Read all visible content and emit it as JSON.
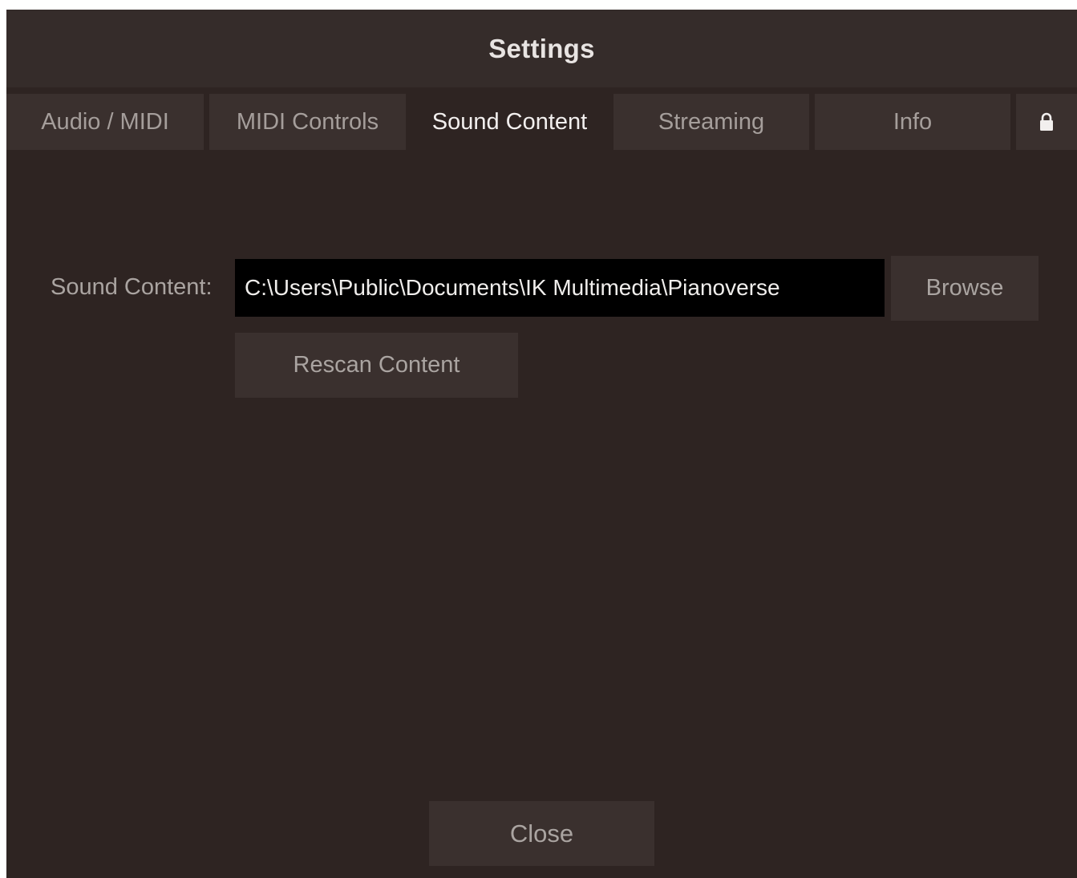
{
  "window": {
    "title": "Settings"
  },
  "tabs": [
    {
      "label": "Audio / MIDI",
      "active": false
    },
    {
      "label": "MIDI Controls",
      "active": false
    },
    {
      "label": "Sound Content",
      "active": true
    },
    {
      "label": "Streaming",
      "active": false
    },
    {
      "label": "Info",
      "active": false
    },
    {
      "icon": "lock-icon",
      "active": false
    }
  ],
  "sound_content": {
    "label": "Sound Content:",
    "path_value": "C:\\Users\\Public\\Documents\\IK Multimedia\\Pianoverse",
    "browse_label": "Browse",
    "rescan_label": "Rescan Content"
  },
  "footer": {
    "close_label": "Close"
  },
  "colors": {
    "background": "#2e2422",
    "titlebar": "#352c2a",
    "button": "#3a302e",
    "text_active": "#f2efee",
    "text_inactive": "#a59e9b",
    "field_background": "#000000"
  }
}
